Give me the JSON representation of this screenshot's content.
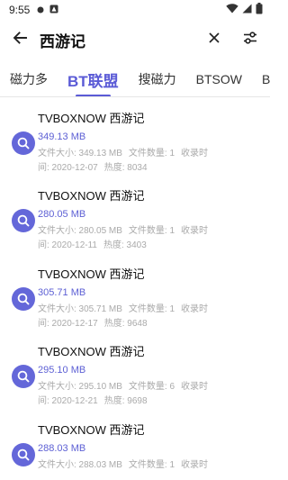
{
  "status_bar": {
    "time": "9:55"
  },
  "search": {
    "query": "西游记"
  },
  "tabs": [
    {
      "label": "磁力多"
    },
    {
      "label": "BT联盟"
    },
    {
      "label": "搜磁力"
    },
    {
      "label": "BTSOW"
    },
    {
      "label": "B"
    }
  ],
  "colors": {
    "accent": "#5b5bd6",
    "icon_bg": "#6467d9",
    "meta": "#aaaaaa"
  },
  "results": [
    {
      "title": "TVBOXNOW 西游记",
      "size": "349.13 MB",
      "file_size": "文件大小: 349.13 MB",
      "file_count": "文件数量: 1",
      "recorded_label": "收录时",
      "recorded_date": "间: 2020-12-07",
      "heat": "热度: 8034"
    },
    {
      "title": "TVBOXNOW 西游记",
      "size": "280.05 MB",
      "file_size": "文件大小: 280.05 MB",
      "file_count": "文件数量: 1",
      "recorded_label": "收录时",
      "recorded_date": "间: 2020-12-11",
      "heat": "热度: 3403"
    },
    {
      "title": "TVBOXNOW 西游记",
      "size": "305.71 MB",
      "file_size": "文件大小: 305.71 MB",
      "file_count": "文件数量: 1",
      "recorded_label": "收录时",
      "recorded_date": "间: 2020-12-17",
      "heat": "热度: 9648"
    },
    {
      "title": "TVBOXNOW 西游记",
      "size": "295.10 MB",
      "file_size": "文件大小: 295.10 MB",
      "file_count": "文件数量: 6",
      "recorded_label": "收录时",
      "recorded_date": "间: 2020-12-21",
      "heat": "热度: 9698"
    },
    {
      "title": "TVBOXNOW 西游记",
      "size": "288.03 MB",
      "file_size": "文件大小: 288.03 MB",
      "file_count": "文件数量: 1",
      "recorded_label": "收录时",
      "recorded_date": "",
      "heat": ""
    }
  ]
}
